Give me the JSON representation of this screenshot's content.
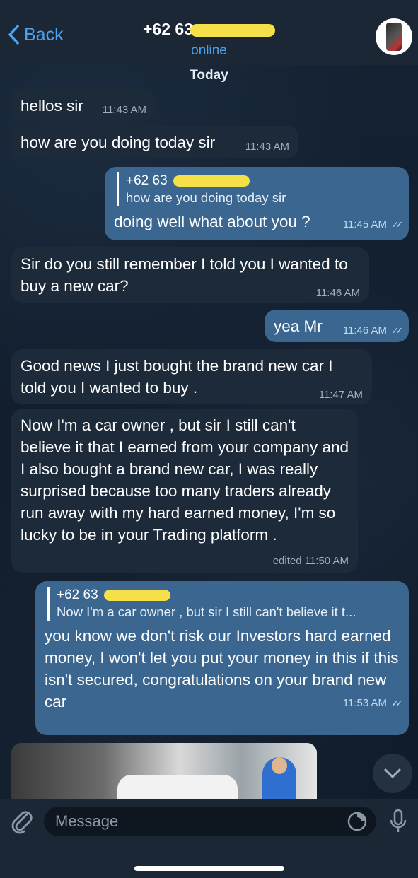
{
  "header": {
    "back_label": "Back",
    "title": "+62 63",
    "status": "online"
  },
  "day_label": "Today",
  "messages": [
    {
      "text": "hellos sir",
      "time": "11:43 AM"
    },
    {
      "text": "how are you doing today sir",
      "time": "11:43 AM"
    },
    {
      "reply_name": "+62 63",
      "reply_text": "how are you doing today sir",
      "text": "doing well what about you ?",
      "time": "11:45 AM"
    },
    {
      "text": "Sir do you still remember I told you I wanted to buy a new car?",
      "time": "11:46 AM"
    },
    {
      "text": "yea Mr",
      "time": "11:46 AM"
    },
    {
      "text": "Good news I just bought the brand new car I told you I wanted to buy .",
      "time": "11:47 AM"
    },
    {
      "text": "Now I'm a car owner , but sir I still can't believe it that I earned from your company and I also bought a brand new car, I was really surprised because too many traders already run away with my hard earned money, I'm so lucky to be in your Trading platform .",
      "time": "edited 11:50 AM"
    },
    {
      "reply_name": "+62 63",
      "reply_text": "Now I'm a car owner , but sir I still can't believe it t...",
      "text": "you know we don't risk our Investors hard earned money, I won't let you put your money in this if this isn't secured, congratulations on your brand new car",
      "time": "11:53 AM"
    }
  ],
  "composer": {
    "placeholder": "Message"
  }
}
